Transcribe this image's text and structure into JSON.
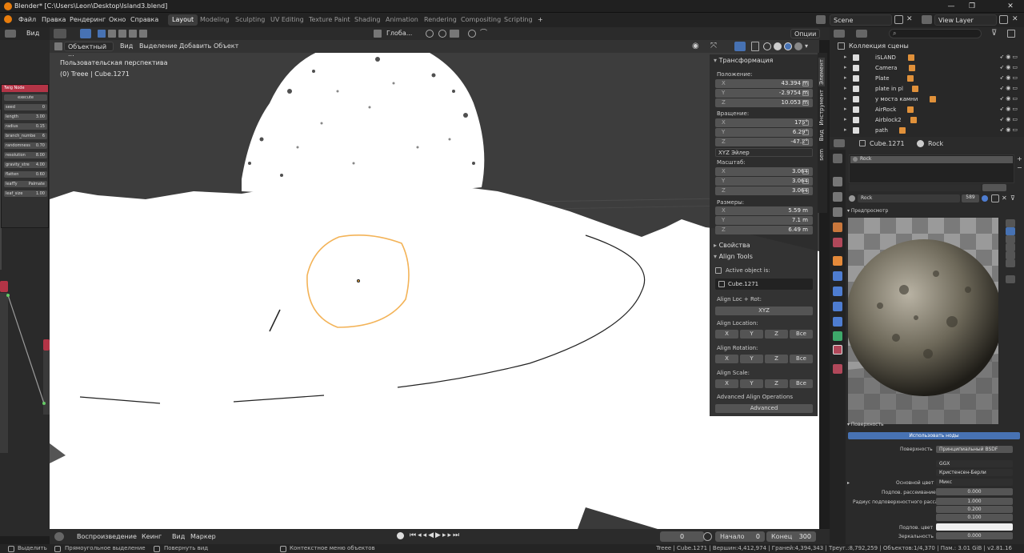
{
  "titlebar": {
    "title": "Blender* [C:\\Users\\Leon\\Desktop\\Island3.blend]",
    "min": "—",
    "max": "❐",
    "close": "✕"
  },
  "menu": [
    "Файл",
    "Правка",
    "Рендеринг",
    "Окно",
    "Справка"
  ],
  "workspaces": [
    "Layout",
    "Modeling",
    "Sculpting",
    "UV Editing",
    "Texture Paint",
    "Shading",
    "Animation",
    "Rendering",
    "Compositing",
    "Scripting"
  ],
  "add_tab": "+",
  "scene": "Scene",
  "view_layer": "View Layer",
  "node_header": {
    "view": "Вид"
  },
  "twig": {
    "title": "Twig Node",
    "execute": "execute",
    "rows": [
      {
        "label": "seed",
        "value": "0"
      },
      {
        "label": "length",
        "value": "3.00"
      },
      {
        "label": "radius",
        "value": "0.15"
      },
      {
        "label": "branch_numbe",
        "value": "6"
      },
      {
        "label": "randomness",
        "value": "0.70"
      },
      {
        "label": "resolution",
        "value": "8.00"
      },
      {
        "label": "gravity_stre",
        "value": "4.00"
      },
      {
        "label": "flatten",
        "value": "0.60"
      },
      {
        "label": "leafTy",
        "value": "Palmate"
      },
      {
        "label": "leaf_size",
        "value": "1.00"
      }
    ]
  },
  "viewport_header": {
    "mode": "Объектный ...",
    "view": "Вид",
    "select": "Выделение",
    "add": "Добавить",
    "object": "Объект",
    "orientation": "Глоба...",
    "options": "Опции"
  },
  "viewport": {
    "perspective": "Пользовательская перспектива",
    "object_info": "(0) Treee | Cube.1271"
  },
  "npanel": {
    "transform": "Трансформация",
    "location_label": "Положение:",
    "location": [
      {
        "ax": "X",
        "v": "43.394 m"
      },
      {
        "ax": "Y",
        "v": "-2.9754 m"
      },
      {
        "ax": "Z",
        "v": "10.053 m"
      }
    ],
    "rotation_label": "Вращение:",
    "rotation": [
      {
        "ax": "X",
        "v": "175°"
      },
      {
        "ax": "Y",
        "v": "6.29°"
      },
      {
        "ax": "Z",
        "v": "-47.2°"
      }
    ],
    "rot_mode": "XYZ Эйлер",
    "scale_label": "Масштаб:",
    "scale": [
      {
        "ax": "X",
        "v": "3.064"
      },
      {
        "ax": "Y",
        "v": "3.064"
      },
      {
        "ax": "Z",
        "v": "3.064"
      }
    ],
    "dims_label": "Размеры:",
    "dims": [
      {
        "ax": "X",
        "v": "5.59 m"
      },
      {
        "ax": "Y",
        "v": "7.1 m"
      },
      {
        "ax": "Z",
        "v": "6.49 m"
      }
    ],
    "properties": "Свойства",
    "align_tools": "Align Tools",
    "active_is": "Active object is:",
    "active_obj": "Cube.1271",
    "align_locrot": "Align Loc + Rot:",
    "xyz": "XYZ",
    "align_loc": "Align Location:",
    "align_rot": "Align Rotation:",
    "align_scale": "Align Scale:",
    "axes": [
      "X",
      "Y",
      "Z",
      "Все"
    ],
    "adv_ops": "Advanced Align Operations",
    "advanced": "Advanced",
    "tabs": [
      "Элемент",
      "Инструмент",
      "Вид",
      "sem"
    ]
  },
  "timeline": {
    "playback": "Воспроизведение",
    "keying": "Кеинг",
    "view": "Вид",
    "marker": "Маркер",
    "frame": "0",
    "start_label": "Начало",
    "start": "0",
    "end_label": "Конец",
    "end": "300"
  },
  "status": {
    "select": "Выделить",
    "box": "Прямоугольное выделение",
    "rotate": "Повернуть вид",
    "context": "Контекстное меню объектов",
    "stats": "Treee | Cube.1271 | Вершин:4,412,974 | Граней:4,394,343 | Треуг.:8,792,259 | Объектов:1/4,370 | Пам.: 3.01 GiB | v2.81.16"
  },
  "outliner": {
    "collection": "Коллекция сцены",
    "items": [
      "iSLAND",
      "Camera",
      "Plate",
      "plate in pl",
      "у моста камни",
      "AirRock",
      "Airblock2",
      "path"
    ]
  },
  "props": {
    "object": "Cube.1271",
    "material": "Rock",
    "slot": "Rock",
    "mat_field": "Rock",
    "users": "589",
    "preview": "Предпросмотр",
    "surface_panel": "Поверхность",
    "use_nodes": "Использовать ноды",
    "surface_label": "Поверхность",
    "surface_val": "Принципиальный BSDF",
    "dist": "GGX",
    "sss_method": "Кристенсен-Берли",
    "base_color": "Основной цвет",
    "base_val": "Микс",
    "subsurf": "Подпов. рассеивание",
    "subsurf_val": "0.000",
    "radius_label": "Радиус подповерхностного расса...",
    "radius": [
      "1.000",
      "0.200",
      "0.100"
    ],
    "subsurf_color": "Подпов. цвет",
    "metallic": "Зеркальность",
    "metallic_val": "0.000"
  },
  "colors": {
    "accent": "#e87d0d",
    "select": "#f1a63b",
    "header": "#2b2b2b",
    "blue": "#4772b3",
    "twig": "#b33446"
  }
}
